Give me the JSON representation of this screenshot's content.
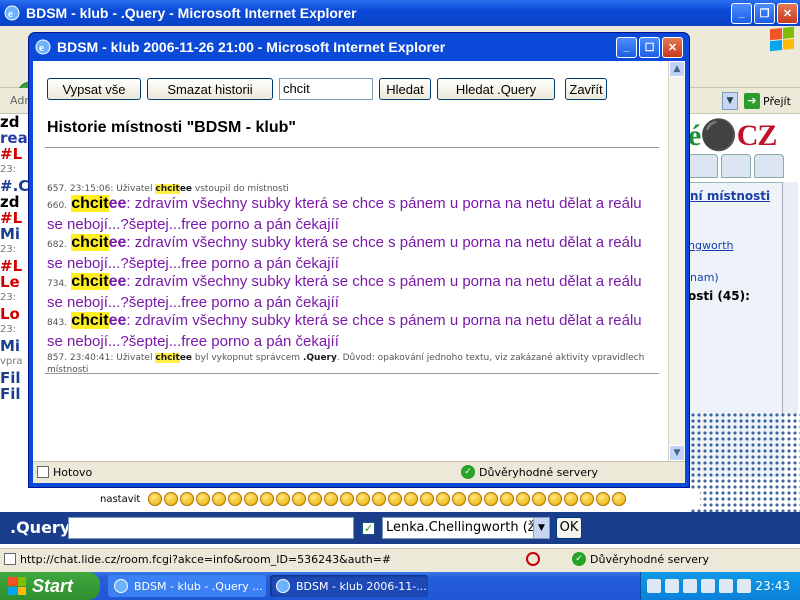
{
  "background_window": {
    "title": "BDSM - klub - .Query - Microsoft Internet Explorer",
    "address_label": "Adr",
    "go_label": "Přejít",
    "left_chat_lines": [
      {
        "text": "zd",
        "color": "#000000"
      },
      {
        "text": "rea",
        "color": "#2b3aa8"
      },
      {
        "text": "#L",
        "color": "#cc0000"
      },
      {
        "text": "23:",
        "color": "#777777"
      },
      {
        "text": "#.C",
        "color": "#1a3e8c"
      },
      {
        "text": "zd",
        "color": "#000000"
      },
      {
        "text": "#L",
        "color": "#cc0000"
      },
      {
        "text": "Mi",
        "color": "#1a3e8c"
      },
      {
        "text": "23:",
        "color": "#777777"
      },
      {
        "text": "#L",
        "color": "#cc0000"
      },
      {
        "text": "Le",
        "color": "#cc0000"
      },
      {
        "text": "23:",
        "color": "#777777"
      },
      {
        "text": "Lo",
        "color": "#cc0000"
      },
      {
        "text": "23:",
        "color": "#777777"
      },
      {
        "text": "Mi",
        "color": "#1a3e8c"
      },
      {
        "text": "vpra",
        "color": "#777777"
      },
      {
        "text": "Fil",
        "color": "#1a3e8c"
      },
      {
        "text": "Fil",
        "color": "#1a3e8c"
      }
    ],
    "right_panel": {
      "logo_text": "CZ",
      "link_partial": "ní místnosti",
      "user_partial": "ngworth",
      "name_partial": "nam)",
      "count_partial": "osti (45):"
    },
    "smiley_label": "nastavit",
    "query_label": ".Query:",
    "query_select": "Lenka.Chellingworth (ž)",
    "ok_label": "OK",
    "status_url": "http://chat.lide.cz/room.fcgi?akce=info&room_ID=536243&auth=#",
    "status_trusted": "Důvěryhodné servery"
  },
  "popup": {
    "title": "BDSM - klub 2006-11-26 21:00 - Microsoft Internet Explorer",
    "buttons": {
      "list_all": "Vypsat vše",
      "clear_history": "Smazat historii",
      "search": "Hledat",
      "search_query": "Hledat .Query",
      "close": "Zavřít"
    },
    "search_value": "chcit",
    "heading": "Historie místnosti \"BDSM - klub\"",
    "messages": {
      "m0": {
        "idx": "657.",
        "time": "23:15:06:",
        "pre": "Uživatel",
        "nick_hl": "chcit",
        "nick_rest": "ee",
        "post": "vstoupil do místnosti"
      },
      "m1": {
        "idx": "660.",
        "nick_hl": "chcit",
        "nick_rest": "ee",
        "text": ": zdravím všechny subky která se chce s pánem u porna na netu dělat a reálu se nebojí...?šeptej...free porno a pán čekajíí"
      },
      "m2": {
        "idx": "682.",
        "nick_hl": "chcit",
        "nick_rest": "ee",
        "text": ": zdravím všechny subky která se chce s pánem u porna na netu dělat a reálu se nebojí...?šeptej...free porno a pán čekajíí"
      },
      "m3": {
        "idx": "734.",
        "nick_hl": "chcit",
        "nick_rest": "ee",
        "text": ": zdravím všechny subky která se chce s pánem u porna na netu dělat a reálu se nebojí...?šeptej...free porno a pán čekajíí"
      },
      "m4": {
        "idx": "843.",
        "nick_hl": "chcit",
        "nick_rest": "ee",
        "text": ": zdravím všechny subky která se chce s pánem u porna na netu dělat a reálu se nebojí...?šeptej...free porno a pán čekajíí"
      },
      "m5": {
        "idx": "857.",
        "time": "23:40:41:",
        "pre": "Uživatel",
        "nick_hl": "chcit",
        "nick_rest": "ee",
        "mid": "byl vykopnut správcem",
        "admin": ".Query",
        "reason_label": ". Důvod:",
        "reason": "opakování jednoho textu, viz zakázané aktivity vpravidlech místnosti"
      }
    },
    "status_done": "Hotovo",
    "status_trusted": "Důvěryhodné servery"
  },
  "taskbar": {
    "start_label": "Start",
    "task1": "BDSM - klub - .Query ...",
    "task2": "BDSM - klub 2006-11-...",
    "clock": "23:43"
  },
  "colors": {
    "xp_blue": "#0b4ad8",
    "message_purple": "#7a1aa8",
    "nick_highlight": "#ffee22",
    "query_bar": "#1a3e8c"
  }
}
